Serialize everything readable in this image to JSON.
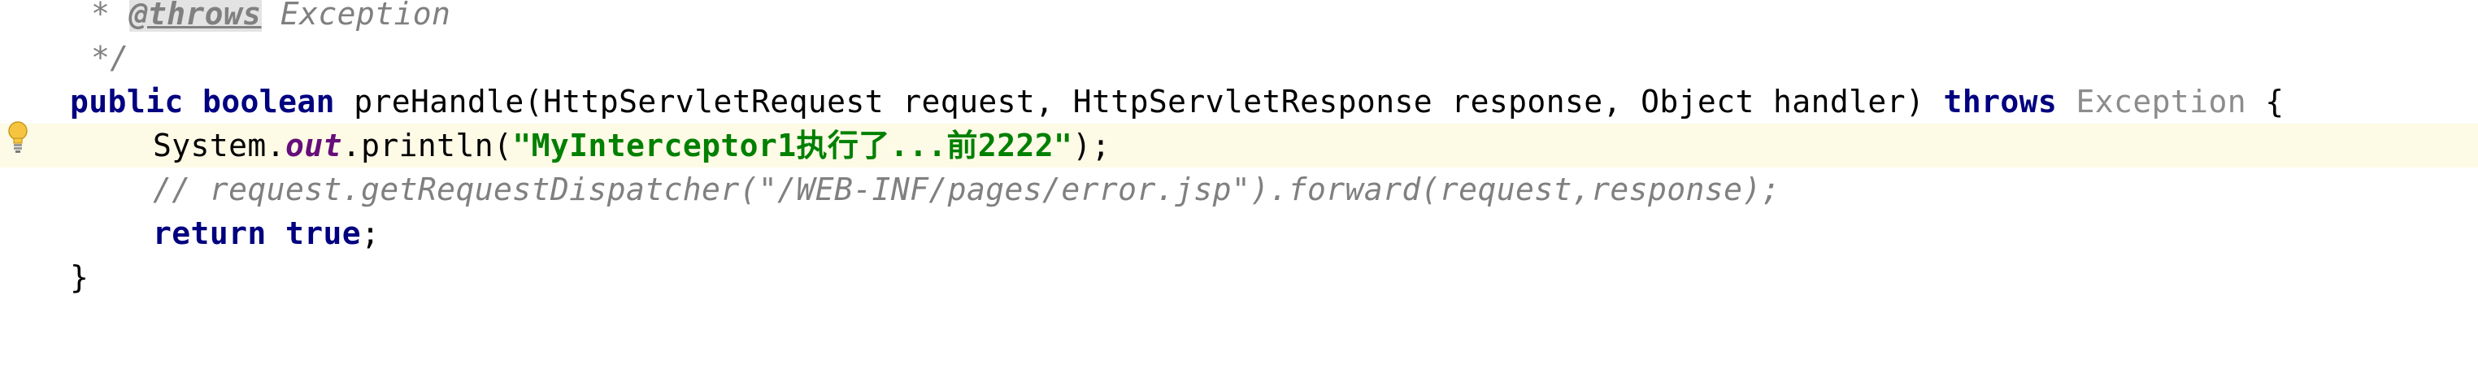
{
  "editor": {
    "lines": [
      {
        "doc_star": "* ",
        "doc_tag": "@throws",
        "doc_text": " Exception"
      },
      {
        "doc_end": "*/"
      },
      {
        "kw_public": "public",
        "kw_boolean": "boolean",
        "signature": "preHandle(HttpServletRequest request, HttpServletResponse response, Object handler)",
        "kw_throws": "throws",
        "exception": "Exception",
        "brace": "{"
      },
      {
        "prefix": "System.",
        "field": "out",
        "call": ".println(",
        "string": "\"MyInterceptor1执行了...前2222\"",
        "suffix": ");"
      },
      {
        "comment": "// request.getRequestDispatcher(\"/WEB-INF/pages/error.jsp\").forward(request,response);"
      },
      {
        "kw_return": "return",
        "kw_true": "true",
        "suffix": ";"
      },
      {
        "brace": "}"
      }
    ]
  },
  "icons": {
    "gutter_bulb": "lightbulb-icon"
  },
  "colors": {
    "keyword": "#000080",
    "string": "#008000",
    "comment": "#808080",
    "field": "#660e7a",
    "caret_row": "#fdfae6"
  }
}
